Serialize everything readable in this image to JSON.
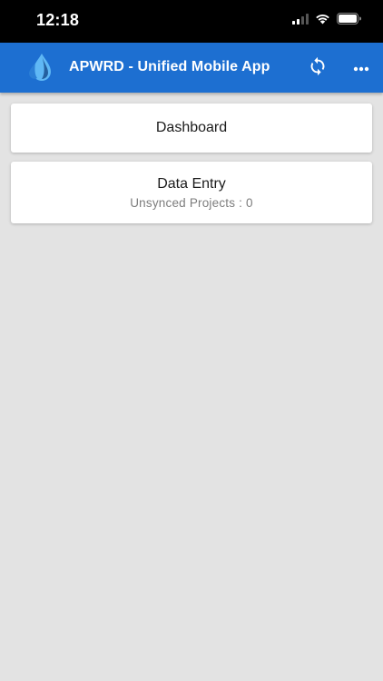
{
  "status_bar": {
    "time": "12:18",
    "icons": [
      "signal-icon",
      "wifi-icon",
      "battery-icon"
    ]
  },
  "app_bar": {
    "title": "APWRD - Unified Mobile App",
    "logo_icon": "water-drop-logo-icon",
    "actions": [
      "sync-icon",
      "more-horizontal-icon"
    ],
    "background_color": "#1d6fd1"
  },
  "menu": {
    "dashboard": {
      "label": "Dashboard"
    },
    "data_entry": {
      "label": "Data Entry",
      "subtitle": "Unsynced Projects : 0"
    }
  },
  "colors": {
    "page_background": "#e3e3e3",
    "card_background": "#ffffff",
    "subtitle_text": "#7d7d7d"
  }
}
